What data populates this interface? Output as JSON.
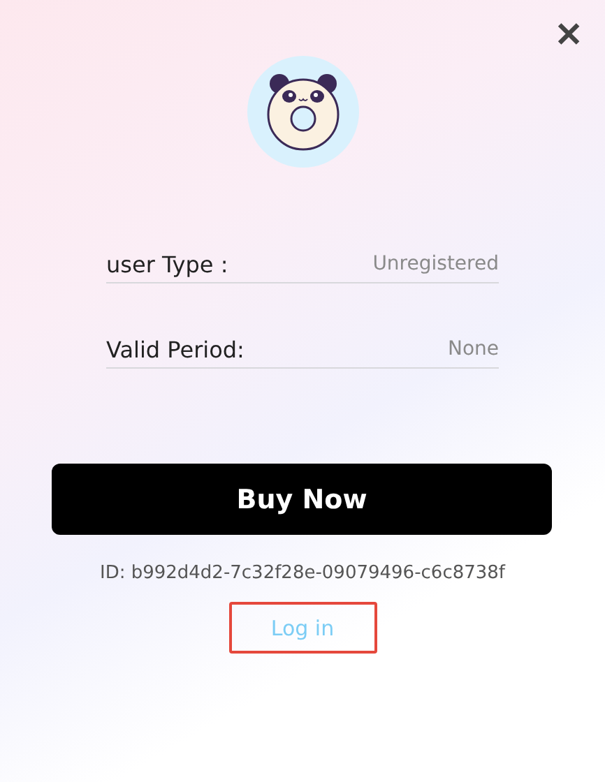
{
  "close_label": "✕",
  "fields": [
    {
      "label": "user Type :",
      "value": "Unregistered"
    },
    {
      "label": "Valid Period:",
      "value": "None"
    }
  ],
  "buy_button": "Buy Now",
  "device_id": "ID: b992d4d2-7c32f28e-09079496-c6c8738f",
  "login_link": "Log in"
}
